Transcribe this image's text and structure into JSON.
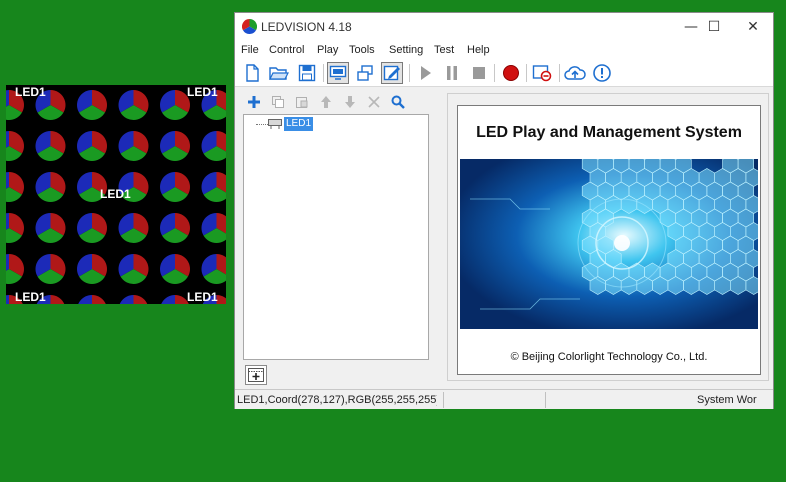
{
  "led_preview": {
    "labels": [
      "LED1",
      "LED1",
      "LED1",
      "LED1",
      "LED1"
    ]
  },
  "window": {
    "title": "LEDVISION 4.18",
    "controls": {
      "minimize": "—",
      "maximize": "☐",
      "close": "✕"
    }
  },
  "menu": [
    "File",
    "Control",
    "Play",
    "Tools",
    "Setting",
    "Test",
    "Help"
  ],
  "toolbar_icons": [
    "new-file-icon",
    "open-folder-icon",
    "save-icon",
    "screen-icon",
    "multi-window-icon",
    "edit-icon",
    "play-icon",
    "pause-icon",
    "stop-icon",
    "record-icon",
    "screen-off-icon",
    "cloud-upload-icon",
    "info-icon"
  ],
  "tree": {
    "node_label": "LED1"
  },
  "splash": {
    "title": "LED Play and Management System",
    "copyright": "© Beijing Colorlight Technology Co., Ltd."
  },
  "status": {
    "info": "LED1,Coord(278,127),RGB(255,255,255)",
    "system": "System Wor"
  },
  "colors": {
    "desktop": "#17861c",
    "accent_blue": "#1e6fd0",
    "record_red": "#d01010",
    "selection": "#3a8ee6"
  }
}
